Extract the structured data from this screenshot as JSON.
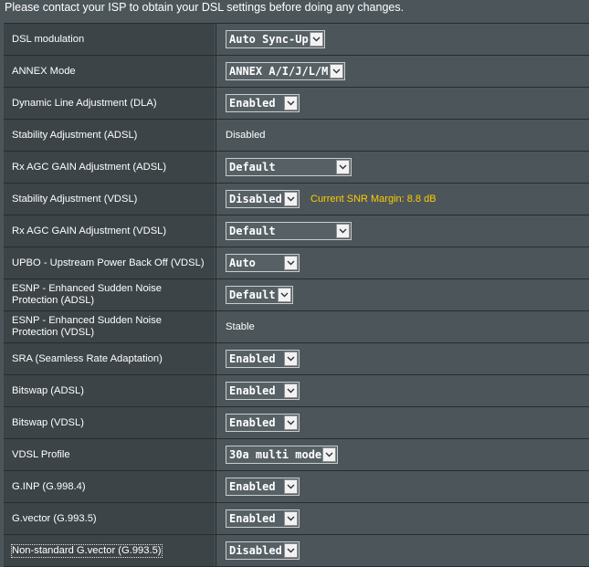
{
  "notice": "Please contact your ISP to obtain your DSL settings before doing any changes.",
  "colors": {
    "background": "#4c565a",
    "label_bg": "#3c4447",
    "highlight": "#ffcc00"
  },
  "rows": [
    {
      "label": "DSL modulation",
      "value": "Auto Sync-Up"
    },
    {
      "label": "ANNEX Mode",
      "value": "ANNEX A/I/J/L/M"
    },
    {
      "label": "Dynamic Line Adjustment (DLA)",
      "value": "Enabled"
    },
    {
      "label": "Stability Adjustment (ADSL)",
      "value": "Disabled"
    },
    {
      "label": "Rx AGC GAIN Adjustment (ADSL)",
      "value": "Default"
    },
    {
      "label": "Stability Adjustment (VDSL)",
      "value": "Disabled",
      "extra": "Current SNR Margin: 8.8 dB"
    },
    {
      "label": "Rx AGC GAIN Adjustment (VDSL)",
      "value": "Default"
    },
    {
      "label": "UPBO - Upstream Power Back Off (VDSL)",
      "value": "Auto"
    },
    {
      "label": "ESNP - Enhanced Sudden Noise Protection (ADSL)",
      "value": "Default"
    },
    {
      "label": "ESNP - Enhanced Sudden Noise Protection (VDSL)",
      "value": "Stable"
    },
    {
      "label": "SRA (Seamless Rate Adaptation)",
      "value": "Enabled"
    },
    {
      "label": "Bitswap (ADSL)",
      "value": "Enabled"
    },
    {
      "label": "Bitswap (VDSL)",
      "value": "Enabled"
    },
    {
      "label": "VDSL Profile",
      "value": "30a multi mode"
    },
    {
      "label": "G.INP (G.998.4)",
      "value": "Enabled"
    },
    {
      "label": "G.vector (G.993.5)",
      "value": "Enabled"
    },
    {
      "label": "Non-standard G.vector (G.993.5)",
      "value": "Disabled"
    }
  ]
}
